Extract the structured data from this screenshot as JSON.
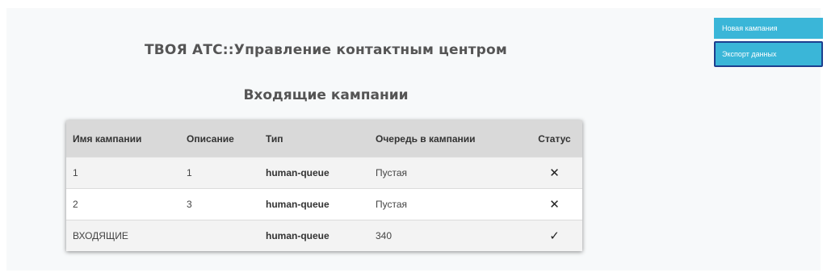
{
  "header": {
    "app_title": "ТВОЯ АТС::Управление контактным центром",
    "section_title": "Входящие кампании"
  },
  "actions": {
    "new_campaign": "Новая кампания",
    "export_data": "Экспорт данных"
  },
  "table": {
    "columns": [
      "Имя кампании",
      "Описание",
      "Тип",
      "Очередь в кампании",
      "Статус"
    ],
    "rows": [
      {
        "name": "1",
        "description": "1",
        "type": "human-queue",
        "queue": "Пустая",
        "status": "✕"
      },
      {
        "name": "2",
        "description": "3",
        "type": "human-queue",
        "queue": "Пустая",
        "status": "✕"
      },
      {
        "name": "ВХОДЯЩИЕ",
        "description": "",
        "type": "human-queue",
        "queue": "340",
        "status": "✓"
      }
    ]
  }
}
